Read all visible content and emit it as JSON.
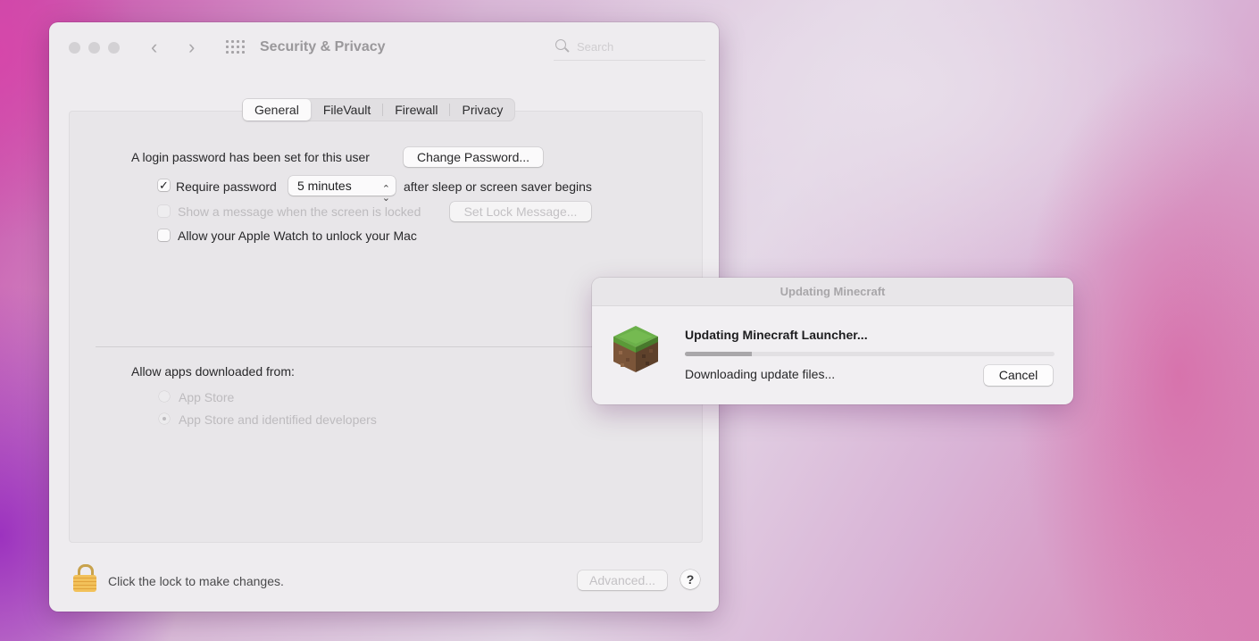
{
  "window": {
    "title": "Security & Privacy",
    "search_placeholder": "Search",
    "tabs": [
      {
        "label": "General",
        "active": true
      },
      {
        "label": "FileVault",
        "active": false
      },
      {
        "label": "Firewall",
        "active": false
      },
      {
        "label": "Privacy",
        "active": false
      }
    ],
    "general": {
      "password_text": "A login password has been set for this user",
      "change_password_label": "Change Password...",
      "require_password_label": "Require password",
      "require_password_checked": true,
      "require_password_delay": "5 minutes",
      "after_sleep_text": "after sleep or screen saver begins",
      "show_message_label": "Show a message when the screen is locked",
      "show_message_checked": false,
      "set_lock_message_label": "Set Lock Message...",
      "apple_watch_label": "Allow your Apple Watch to unlock your Mac",
      "apple_watch_checked": false,
      "allow_apps_heading": "Allow apps downloaded from:",
      "app_sources": [
        {
          "label": "App Store",
          "selected": false
        },
        {
          "label": "App Store and identified developers",
          "selected": true
        }
      ]
    },
    "footer": {
      "lock_text": "Click the lock to make changes.",
      "advanced_label": "Advanced...",
      "help_label": "?"
    }
  },
  "dialog": {
    "title": "Updating Minecraft",
    "heading": "Updating Minecraft Launcher...",
    "status": "Downloading update files...",
    "progress_fraction": 0.18,
    "cancel_label": "Cancel",
    "icon": "minecraft-grass-block-icon"
  },
  "colors": {
    "grass": "#5e9e3c",
    "dirt": "#866043"
  }
}
